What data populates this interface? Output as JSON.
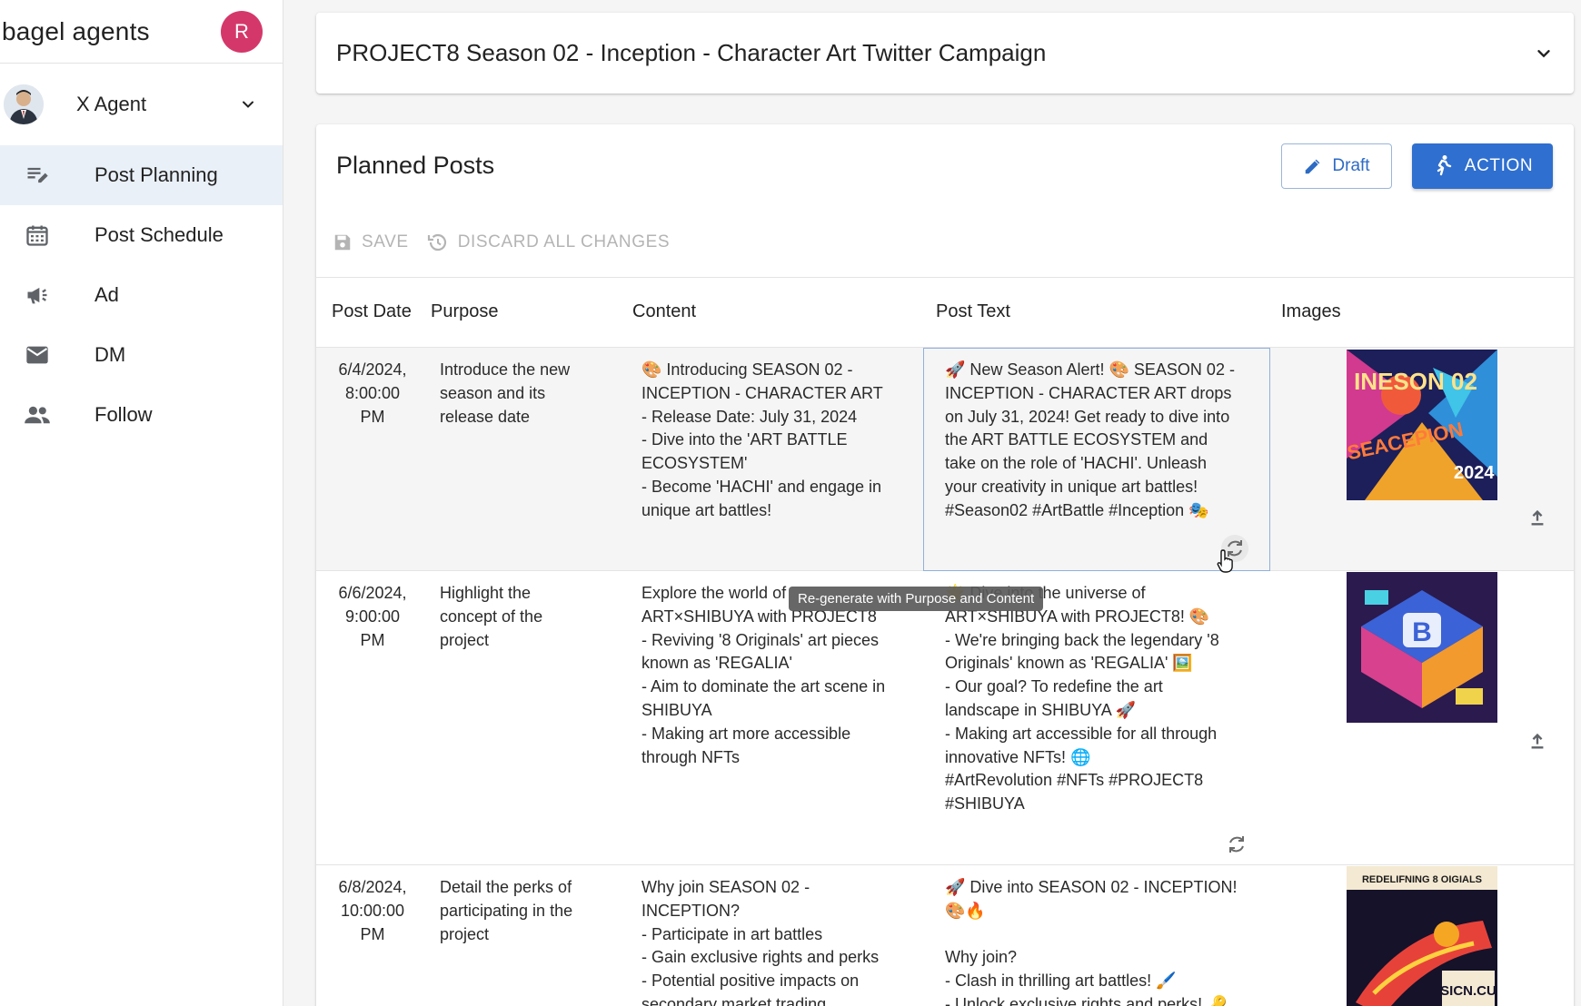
{
  "brand": {
    "name": "bagel agents",
    "user_initial": "R"
  },
  "agent": {
    "name": "X Agent"
  },
  "sidebar": {
    "items": [
      {
        "label": "Post Planning",
        "icon": "post-planning-icon"
      },
      {
        "label": "Post Schedule",
        "icon": "calendar-icon"
      },
      {
        "label": "Ad",
        "icon": "megaphone-icon"
      },
      {
        "label": "DM",
        "icon": "mail-icon"
      },
      {
        "label": "Follow",
        "icon": "people-icon"
      }
    ]
  },
  "campaign": {
    "title": "PROJECT8 Season 02 - Inception - Character Art Twitter Campaign"
  },
  "planned": {
    "title": "Planned Posts",
    "draft_label": "Draft",
    "action_label": "ACTION",
    "save_label": "SAVE",
    "discard_label": "DISCARD ALL CHANGES"
  },
  "table": {
    "columns": [
      "Post Date",
      "Purpose",
      "Content",
      "Post Text",
      "Images"
    ],
    "rows": [
      {
        "date": "6/4/2024,\n8:00:00\nPM",
        "purpose": "Introduce the new\nseason and its\nrelease date",
        "content": "🎨 Introducing SEASON 02 -\nINCEPTION - CHARACTER ART\n- Release Date: July 31, 2024\n- Dive into the 'ART BATTLE\nECOSYSTEM'\n- Become 'HACHI' and engage in\nunique art battles!",
        "text": "🚀 New Season Alert! 🎨 SEASON 02 -\nINCEPTION - CHARACTER ART drops\non July 31, 2024! Get ready to dive into\nthe ART BATTLE ECOSYSTEM and\ntake on the role of 'HACHI'. Unleash\nyour creativity in unique art battles!\n#Season02 #ArtBattle #Inception 🎭"
      },
      {
        "date": "6/6/2024,\n9:00:00\nPM",
        "purpose": "Highlight the\nconcept of the\nproject",
        "content": "Explore the world of\nART×SHIBUYA with PROJECT8\n- Reviving '8 Originals' art pieces\nknown as 'REGALIA'\n- Aim to dominate the art scene in\nSHIBUYA\n- Making art more accessible\nthrough NFTs",
        "text": "🌟 Dive into the universe of\nART×SHIBUYA with PROJECT8! 🎨\n- We're bringing back the legendary '8\nOriginals' known as 'REGALIA' 🖼️\n- Our goal? To redefine the art\nlandscape in SHIBUYA 🚀\n- Making art accessible for all through\ninnovative NFTs! 🌐\n#ArtRevolution #NFTs #PROJECT8\n#SHIBUYA"
      },
      {
        "date": "6/8/2024,\n10:00:00\nPM",
        "purpose": "Detail the perks of\nparticipating in the\nproject",
        "content": "Why join SEASON 02 -\nINCEPTION?\n- Participate in art battles\n- Gain exclusive rights and perks\n- Potential positive impacts on\nsecondary market trading",
        "text": "🚀 Dive into SEASON 02 - INCEPTION!\n🎨🔥\n\nWhy join?\n- Clash in thrilling art battles! 🖌️\n- Unlock exclusive rights and perks! 🔑"
      }
    ]
  },
  "tooltip": {
    "text": "Re-generate with Purpose and Content"
  },
  "images": [
    {
      "caption": "INESON 02",
      "subcaption": "SEACEPION",
      "year": "2024"
    },
    {
      "caption": "B"
    },
    {
      "caption": "REDELIFNING 8 OIGIALS",
      "subcaption": "SICN.CU"
    }
  ],
  "colors": {
    "accent": "#2f6fcf",
    "avatar": "#d4386a",
    "active_nav": "#eaf0f8"
  }
}
